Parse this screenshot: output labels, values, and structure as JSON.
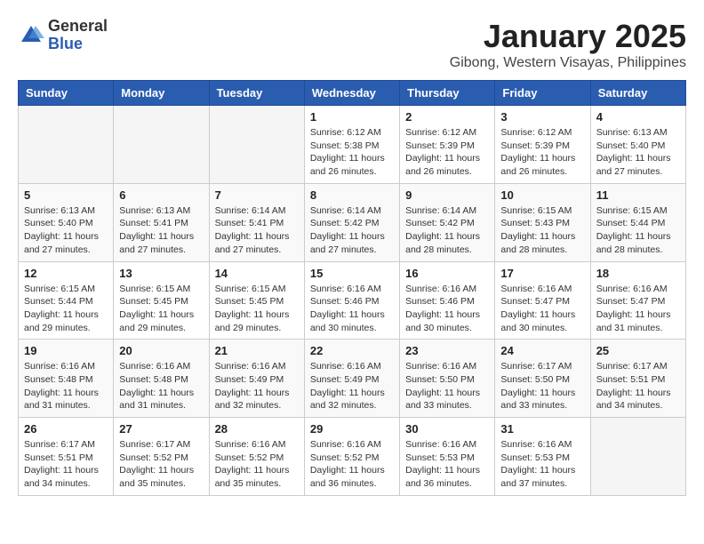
{
  "logo": {
    "general": "General",
    "blue": "Blue"
  },
  "header": {
    "month": "January 2025",
    "location": "Gibong, Western Visayas, Philippines"
  },
  "weekdays": [
    "Sunday",
    "Monday",
    "Tuesday",
    "Wednesday",
    "Thursday",
    "Friday",
    "Saturday"
  ],
  "weeks": [
    [
      {
        "day": "",
        "sunrise": "",
        "sunset": "",
        "daylight": ""
      },
      {
        "day": "",
        "sunrise": "",
        "sunset": "",
        "daylight": ""
      },
      {
        "day": "",
        "sunrise": "",
        "sunset": "",
        "daylight": ""
      },
      {
        "day": "1",
        "sunrise": "Sunrise: 6:12 AM",
        "sunset": "Sunset: 5:38 PM",
        "daylight": "Daylight: 11 hours and 26 minutes."
      },
      {
        "day": "2",
        "sunrise": "Sunrise: 6:12 AM",
        "sunset": "Sunset: 5:39 PM",
        "daylight": "Daylight: 11 hours and 26 minutes."
      },
      {
        "day": "3",
        "sunrise": "Sunrise: 6:12 AM",
        "sunset": "Sunset: 5:39 PM",
        "daylight": "Daylight: 11 hours and 26 minutes."
      },
      {
        "day": "4",
        "sunrise": "Sunrise: 6:13 AM",
        "sunset": "Sunset: 5:40 PM",
        "daylight": "Daylight: 11 hours and 27 minutes."
      }
    ],
    [
      {
        "day": "5",
        "sunrise": "Sunrise: 6:13 AM",
        "sunset": "Sunset: 5:40 PM",
        "daylight": "Daylight: 11 hours and 27 minutes."
      },
      {
        "day": "6",
        "sunrise": "Sunrise: 6:13 AM",
        "sunset": "Sunset: 5:41 PM",
        "daylight": "Daylight: 11 hours and 27 minutes."
      },
      {
        "day": "7",
        "sunrise": "Sunrise: 6:14 AM",
        "sunset": "Sunset: 5:41 PM",
        "daylight": "Daylight: 11 hours and 27 minutes."
      },
      {
        "day": "8",
        "sunrise": "Sunrise: 6:14 AM",
        "sunset": "Sunset: 5:42 PM",
        "daylight": "Daylight: 11 hours and 27 minutes."
      },
      {
        "day": "9",
        "sunrise": "Sunrise: 6:14 AM",
        "sunset": "Sunset: 5:42 PM",
        "daylight": "Daylight: 11 hours and 28 minutes."
      },
      {
        "day": "10",
        "sunrise": "Sunrise: 6:15 AM",
        "sunset": "Sunset: 5:43 PM",
        "daylight": "Daylight: 11 hours and 28 minutes."
      },
      {
        "day": "11",
        "sunrise": "Sunrise: 6:15 AM",
        "sunset": "Sunset: 5:44 PM",
        "daylight": "Daylight: 11 hours and 28 minutes."
      }
    ],
    [
      {
        "day": "12",
        "sunrise": "Sunrise: 6:15 AM",
        "sunset": "Sunset: 5:44 PM",
        "daylight": "Daylight: 11 hours and 29 minutes."
      },
      {
        "day": "13",
        "sunrise": "Sunrise: 6:15 AM",
        "sunset": "Sunset: 5:45 PM",
        "daylight": "Daylight: 11 hours and 29 minutes."
      },
      {
        "day": "14",
        "sunrise": "Sunrise: 6:15 AM",
        "sunset": "Sunset: 5:45 PM",
        "daylight": "Daylight: 11 hours and 29 minutes."
      },
      {
        "day": "15",
        "sunrise": "Sunrise: 6:16 AM",
        "sunset": "Sunset: 5:46 PM",
        "daylight": "Daylight: 11 hours and 30 minutes."
      },
      {
        "day": "16",
        "sunrise": "Sunrise: 6:16 AM",
        "sunset": "Sunset: 5:46 PM",
        "daylight": "Daylight: 11 hours and 30 minutes."
      },
      {
        "day": "17",
        "sunrise": "Sunrise: 6:16 AM",
        "sunset": "Sunset: 5:47 PM",
        "daylight": "Daylight: 11 hours and 30 minutes."
      },
      {
        "day": "18",
        "sunrise": "Sunrise: 6:16 AM",
        "sunset": "Sunset: 5:47 PM",
        "daylight": "Daylight: 11 hours and 31 minutes."
      }
    ],
    [
      {
        "day": "19",
        "sunrise": "Sunrise: 6:16 AM",
        "sunset": "Sunset: 5:48 PM",
        "daylight": "Daylight: 11 hours and 31 minutes."
      },
      {
        "day": "20",
        "sunrise": "Sunrise: 6:16 AM",
        "sunset": "Sunset: 5:48 PM",
        "daylight": "Daylight: 11 hours and 31 minutes."
      },
      {
        "day": "21",
        "sunrise": "Sunrise: 6:16 AM",
        "sunset": "Sunset: 5:49 PM",
        "daylight": "Daylight: 11 hours and 32 minutes."
      },
      {
        "day": "22",
        "sunrise": "Sunrise: 6:16 AM",
        "sunset": "Sunset: 5:49 PM",
        "daylight": "Daylight: 11 hours and 32 minutes."
      },
      {
        "day": "23",
        "sunrise": "Sunrise: 6:16 AM",
        "sunset": "Sunset: 5:50 PM",
        "daylight": "Daylight: 11 hours and 33 minutes."
      },
      {
        "day": "24",
        "sunrise": "Sunrise: 6:17 AM",
        "sunset": "Sunset: 5:50 PM",
        "daylight": "Daylight: 11 hours and 33 minutes."
      },
      {
        "day": "25",
        "sunrise": "Sunrise: 6:17 AM",
        "sunset": "Sunset: 5:51 PM",
        "daylight": "Daylight: 11 hours and 34 minutes."
      }
    ],
    [
      {
        "day": "26",
        "sunrise": "Sunrise: 6:17 AM",
        "sunset": "Sunset: 5:51 PM",
        "daylight": "Daylight: 11 hours and 34 minutes."
      },
      {
        "day": "27",
        "sunrise": "Sunrise: 6:17 AM",
        "sunset": "Sunset: 5:52 PM",
        "daylight": "Daylight: 11 hours and 35 minutes."
      },
      {
        "day": "28",
        "sunrise": "Sunrise: 6:16 AM",
        "sunset": "Sunset: 5:52 PM",
        "daylight": "Daylight: 11 hours and 35 minutes."
      },
      {
        "day": "29",
        "sunrise": "Sunrise: 6:16 AM",
        "sunset": "Sunset: 5:52 PM",
        "daylight": "Daylight: 11 hours and 36 minutes."
      },
      {
        "day": "30",
        "sunrise": "Sunrise: 6:16 AM",
        "sunset": "Sunset: 5:53 PM",
        "daylight": "Daylight: 11 hours and 36 minutes."
      },
      {
        "day": "31",
        "sunrise": "Sunrise: 6:16 AM",
        "sunset": "Sunset: 5:53 PM",
        "daylight": "Daylight: 11 hours and 37 minutes."
      },
      {
        "day": "",
        "sunrise": "",
        "sunset": "",
        "daylight": ""
      }
    ]
  ]
}
